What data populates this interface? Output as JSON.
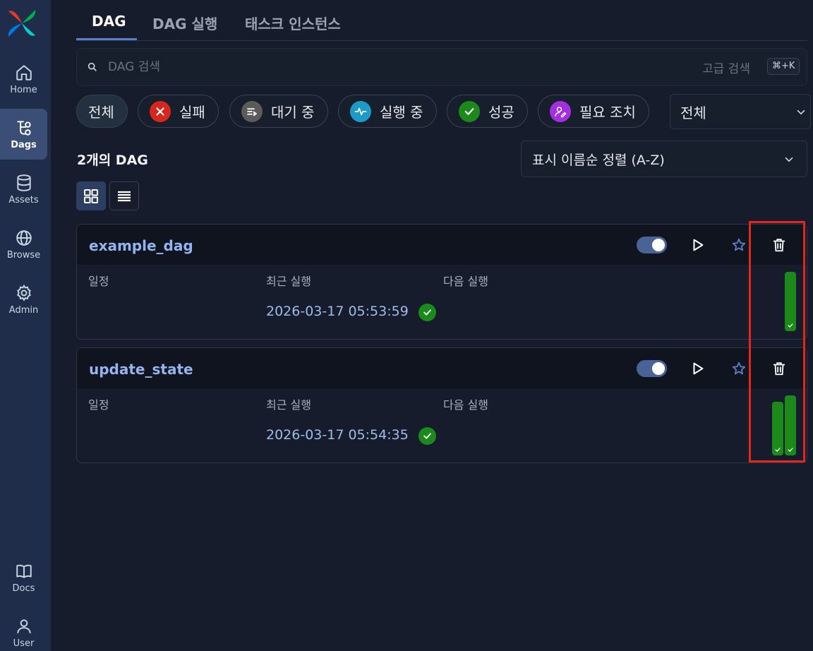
{
  "sidebar": {
    "items": [
      {
        "label": "Home",
        "icon": "home-icon"
      },
      {
        "label": "Dags",
        "icon": "dags-icon"
      },
      {
        "label": "Assets",
        "icon": "database-icon"
      },
      {
        "label": "Browse",
        "icon": "globe-icon"
      },
      {
        "label": "Admin",
        "icon": "gear-icon"
      },
      {
        "label": "Docs",
        "icon": "book-icon"
      },
      {
        "label": "User",
        "icon": "user-icon"
      }
    ],
    "active": "Dags"
  },
  "tabs": [
    {
      "label": "DAG",
      "active": true
    },
    {
      "label": "DAG 실행",
      "active": false
    },
    {
      "label": "태스크 인스턴스",
      "active": false
    }
  ],
  "search": {
    "placeholder": "DAG 검색",
    "value": "",
    "advanced_label": "고급 검색",
    "shortcut": "⌘+K"
  },
  "filters": [
    {
      "label": "전체",
      "icon": null,
      "color": null,
      "selected": true
    },
    {
      "label": "실패",
      "icon": "x-icon",
      "color": "#d6261e"
    },
    {
      "label": "대기 중",
      "icon": "queue-icon",
      "color": "#5b5b5b"
    },
    {
      "label": "실행 중",
      "icon": "pulse-icon",
      "color": "#1d9ac8"
    },
    {
      "label": "성공",
      "icon": "check-icon",
      "color": "#1b8a1b"
    },
    {
      "label": "필요 조치",
      "icon": "user-edit-icon",
      "color": "#a42fe0"
    }
  ],
  "state_select": {
    "value": "전체"
  },
  "dag_count_label": "2개의 DAG",
  "sort_select": {
    "value": "표시 이름순 정렬 (A-Z)"
  },
  "view_modes": [
    "grid",
    "list"
  ],
  "field_labels": {
    "schedule": "일정",
    "last_run": "최근 실행",
    "next_run": "다음 실행"
  },
  "dags": [
    {
      "name": "example_dag",
      "paused": false,
      "last_run": "2026-03-17 05:53:59",
      "last_run_state": "success",
      "recent_runs": [
        "success"
      ]
    },
    {
      "name": "update_state",
      "paused": false,
      "last_run": "2026-03-17 05:54:35",
      "last_run_state": "success",
      "recent_runs": [
        "success",
        "success"
      ]
    }
  ],
  "colors": {
    "accent": "#5c7fc7",
    "success": "#1b8a1b",
    "highlight": "#e5261a"
  }
}
